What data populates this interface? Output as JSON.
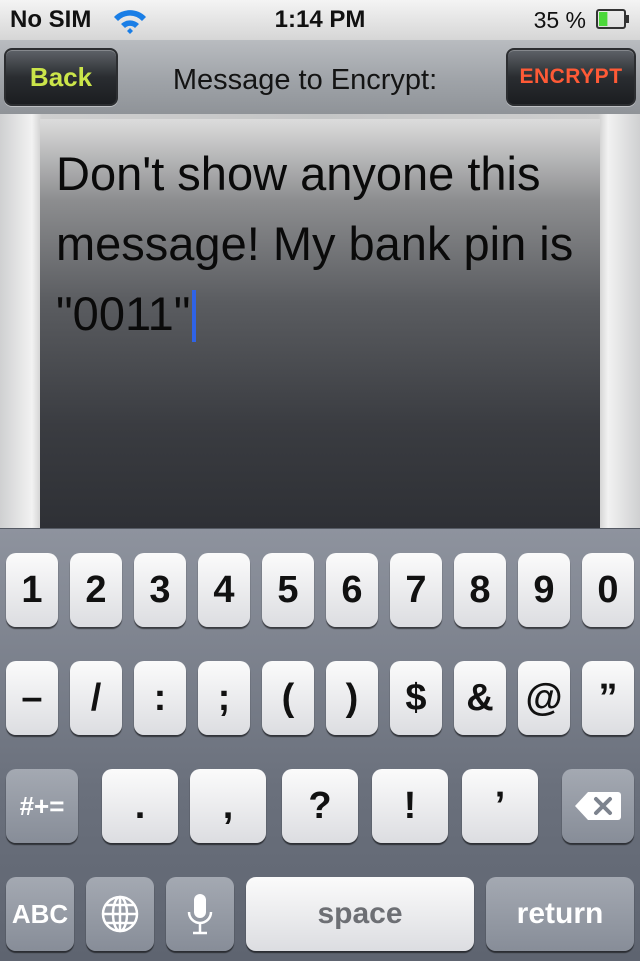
{
  "status_bar": {
    "carrier": "No SIM",
    "time": "1:14 PM",
    "battery": "35 %",
    "battery_level": 0.35
  },
  "nav": {
    "back_label": "Back",
    "title": "Message to Encrypt:",
    "encrypt_label": "ENCRYPT"
  },
  "message": {
    "text": "Don't show anyone this message! My bank pin is \"0011\""
  },
  "keyboard": {
    "row1": [
      "1",
      "2",
      "3",
      "4",
      "5",
      "6",
      "7",
      "8",
      "9",
      "0"
    ],
    "row2": [
      "–",
      "/",
      ":",
      ";",
      "(",
      ")",
      "$",
      "&",
      "@",
      "”"
    ],
    "row3": {
      "shift": "#+=",
      "keys": [
        ".",
        ",",
        "?",
        "!",
        "’"
      ]
    },
    "row4": {
      "abc": "ABC",
      "space": "space",
      "return": "return"
    }
  },
  "icons": [
    "wifi-icon",
    "battery-icon",
    "globe-icon",
    "mic-icon",
    "backspace-icon"
  ]
}
